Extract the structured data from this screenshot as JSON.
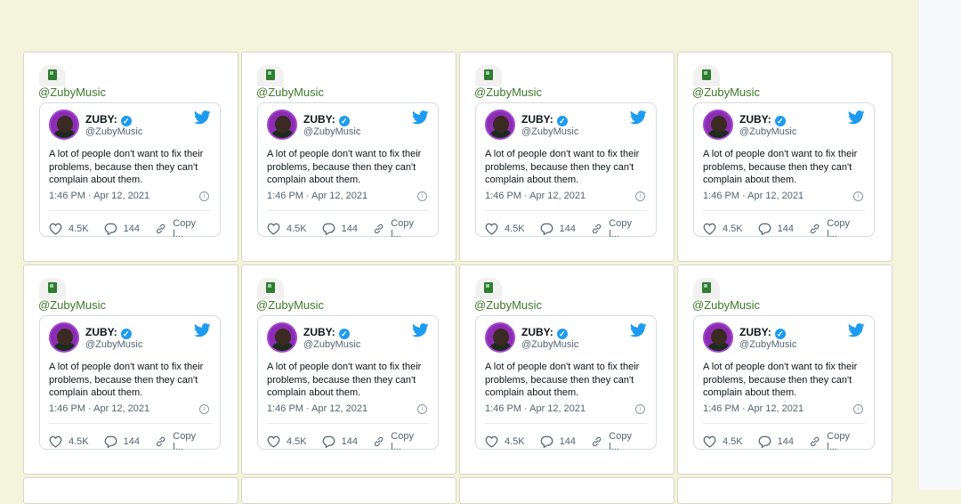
{
  "cards": [
    {
      "source": "@ZubyMusic",
      "name": "ZUBY:",
      "handle": "@ZubyMusic",
      "text": "A lot of people don't want to fix their problems, because then they can't complain about them.",
      "time": "1:46 PM · Apr 12, 2021",
      "likes": "4.5K",
      "replies": "144",
      "copy": "Copy l..."
    },
    {
      "source": "@ZubyMusic",
      "name": "ZUBY:",
      "handle": "@ZubyMusic",
      "text": "A lot of people don't want to fix their problems, because then they can't complain about them.",
      "time": "1:46 PM · Apr 12, 2021",
      "likes": "4.5K",
      "replies": "144",
      "copy": "Copy l..."
    },
    {
      "source": "@ZubyMusic",
      "name": "ZUBY:",
      "handle": "@ZubyMusic",
      "text": "A lot of people don't want to fix their problems, because then they can't complain about them.",
      "time": "1:46 PM · Apr 12, 2021",
      "likes": "4.5K",
      "replies": "144",
      "copy": "Copy l..."
    },
    {
      "source": "@ZubyMusic",
      "name": "ZUBY:",
      "handle": "@ZubyMusic",
      "text": "A lot of people don't want to fix their problems, because then they can't complain about them.",
      "time": "1:46 PM · Apr 12, 2021",
      "likes": "4.5K",
      "replies": "144",
      "copy": "Copy l..."
    },
    {
      "source": "@ZubyMusic",
      "name": "ZUBY:",
      "handle": "@ZubyMusic",
      "text": "A lot of people don't want to fix their problems, because then they can't complain about them.",
      "time": "1:46 PM · Apr 12, 2021",
      "likes": "4.5K",
      "replies": "144",
      "copy": "Copy l..."
    },
    {
      "source": "@ZubyMusic",
      "name": "ZUBY:",
      "handle": "@ZubyMusic",
      "text": "A lot of people don't want to fix their problems, because then they can't complain about them.",
      "time": "1:46 PM · Apr 12, 2021",
      "likes": "4.5K",
      "replies": "144",
      "copy": "Copy l..."
    },
    {
      "source": "@ZubyMusic",
      "name": "ZUBY:",
      "handle": "@ZubyMusic",
      "text": "A lot of people don't want to fix their problems, because then they can't complain about them.",
      "time": "1:46 PM · Apr 12, 2021",
      "likes": "4.5K",
      "replies": "144",
      "copy": "Copy l..."
    },
    {
      "source": "@ZubyMusic",
      "name": "ZUBY:",
      "handle": "@ZubyMusic",
      "text": "A lot of people don't want to fix their problems, because then they can't complain about them.",
      "time": "1:46 PM · Apr 12, 2021",
      "likes": "4.5K",
      "replies": "144",
      "copy": "Copy l..."
    }
  ],
  "colors": {
    "background": "#f4f4dd",
    "source_link": "#3c7a28",
    "twitter_blue": "#1d9bf0",
    "avatar_ring": "#a345cf"
  },
  "icons": {
    "favicon": "green-bookmark-icon",
    "bird": "twitter-bird-icon",
    "verified": "verified-badge-icon",
    "like": "heart-icon",
    "reply": "reply-bubble-icon",
    "copy": "link-icon",
    "info": "info-icon"
  }
}
